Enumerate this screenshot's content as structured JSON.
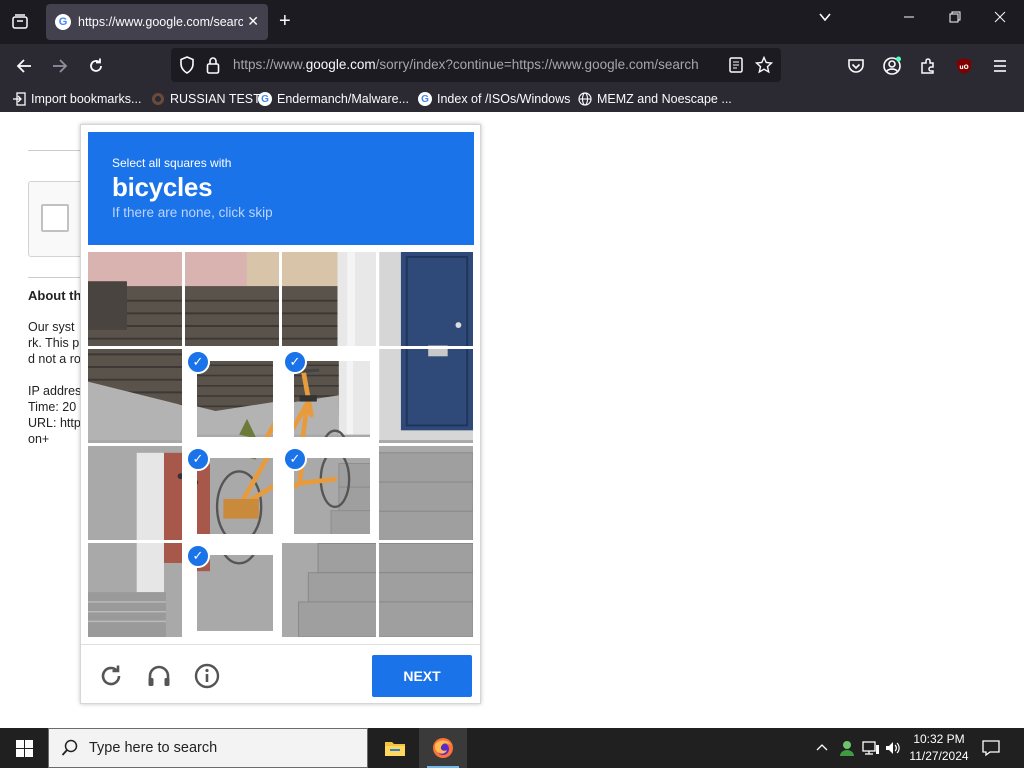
{
  "browser": {
    "tab": {
      "title": "https://www.google.com/searc",
      "favicon": "google-icon"
    },
    "url": {
      "prefix": "https://www.",
      "domain": "google.com",
      "rest": "/sorry/index?continue=https://www.google.com/search"
    },
    "bookmarks": [
      {
        "label": "Import bookmarks...",
        "icon": "import-icon"
      },
      {
        "label": "RUSSIAN TEST",
        "icon": "site-icon"
      },
      {
        "label": "Endermanch/Malware...",
        "icon": "google-icon"
      },
      {
        "label": "Index of /ISOs/Windows",
        "icon": "google-icon"
      },
      {
        "label": "MEMZ and Noescape ...",
        "icon": "globe-icon"
      }
    ]
  },
  "page": {
    "about_heading": "About th",
    "lines": [
      "Our syst",
      "rk. This p",
      "d not a ro",
      "",
      "IP addres",
      "Time: 20",
      "URL: http",
      "on+"
    ]
  },
  "captcha": {
    "instruction_line1": "Select all squares with",
    "target": "bicycles",
    "instruction_line3": "If there are none, click skip",
    "selected_tiles": [
      5,
      6,
      9,
      10,
      13
    ],
    "next_label": "NEXT",
    "accent": "#1a73e8"
  },
  "taskbar": {
    "search_placeholder": "Type here to search",
    "time": "10:32 PM",
    "date": "11/27/2024"
  }
}
